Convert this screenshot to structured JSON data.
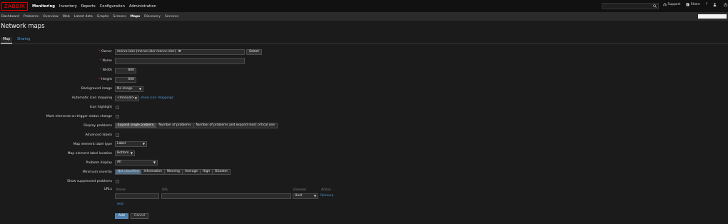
{
  "header": {
    "logo": "ZABBIX",
    "menu": [
      "Monitoring",
      "Inventory",
      "Reports",
      "Configuration",
      "Administration"
    ],
    "active_menu": "Monitoring",
    "support_label": "Support",
    "share_label": "Share",
    "help_label": "?"
  },
  "submenu": {
    "items": [
      "Dashboard",
      "Problems",
      "Overview",
      "Web",
      "Latest data",
      "Graphs",
      "Screens",
      "Maps",
      "Discovery",
      "Services"
    ],
    "active": "Maps"
  },
  "page_title": "Network maps",
  "tabs": {
    "map": "Map",
    "sharing": "Sharing"
  },
  "form": {
    "owner_label": "Owner",
    "owner_value": "merve.isler (merve.isler merve.isler)",
    "owner_remove": "✖",
    "select_label": "Select",
    "name_label": "Name",
    "name_value": "",
    "width_label": "Width",
    "width_value": "800",
    "height_label": "Height",
    "height_value": "600",
    "bg_label": "Background image",
    "bg_value": "No image",
    "icon_mapping_label": "Automatic icon mapping",
    "icon_mapping_value": "<manual>",
    "show_icon_mappings": "show icon mappings",
    "icon_highlight_label": "Icon highlight",
    "mark_elements_label": "Mark elements on trigger status change",
    "display_problems_label": "Display problems",
    "display_problems_options": [
      "Expand single problem",
      "Number of problems",
      "Number of problems and expand most critical one"
    ],
    "display_problems_selected": "Expand single problem",
    "advanced_labels_label": "Advanced labels",
    "label_type_label": "Map element label type",
    "label_type_value": "Label",
    "label_location_label": "Map element label location",
    "label_location_value": "Bottom",
    "problem_display_label": "Problem display",
    "problem_display_value": "All",
    "min_severity_label": "Minimum severity",
    "severity_options": [
      "Not classified",
      "Information",
      "Warning",
      "Average",
      "High",
      "Disaster"
    ],
    "severity_selected": "Not classified",
    "suppressed_label": "Show suppressed problems",
    "urls_label": "URLs",
    "urls_headers": [
      "Name",
      "URL",
      "Element",
      "Action"
    ],
    "urls_row": {
      "name": "",
      "url": "",
      "element": "Host",
      "action": "Remove"
    },
    "add_link": "Add",
    "add_button": "Add",
    "cancel_button": "Cancel"
  }
}
